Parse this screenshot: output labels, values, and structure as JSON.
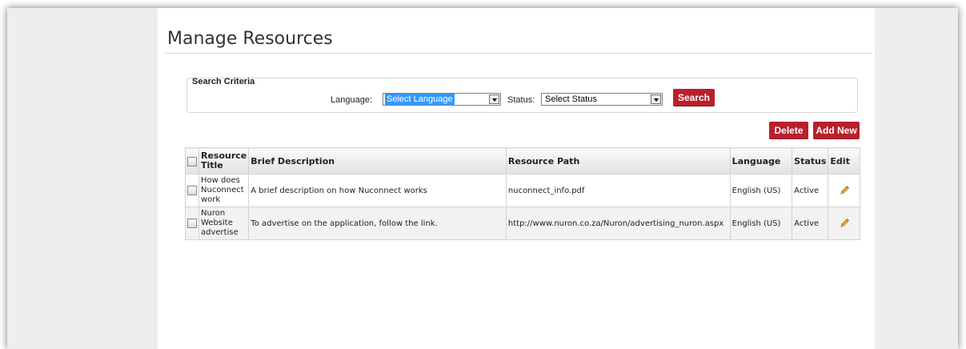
{
  "page": {
    "title": "Manage Resources"
  },
  "search": {
    "legend": "Search Criteria",
    "language_label": "Language:",
    "language_value": "Select Language",
    "status_label": "Status:",
    "status_value": "Select Status",
    "search_label": "Search"
  },
  "actions": {
    "delete_label": "Delete",
    "add_new_label": "Add New"
  },
  "table": {
    "headers": {
      "resource_title": "Resource Title",
      "brief_description": "Brief Description",
      "resource_path": "Resource Path",
      "language": "Language",
      "status": "Status",
      "edit": "Edit"
    },
    "rows": [
      {
        "title": "How does Nuconnect work",
        "description": "A brief description on how Nuconnect works",
        "path": "nuconnect_info.pdf",
        "language": "English (US)",
        "status": "Active"
      },
      {
        "title": "Nuron Website advertise",
        "description": "To advertise on the application, follow the link.",
        "path": "http://www.nuron.co.za/Nuron/advertising_nuron.aspx",
        "language": "English (US)",
        "status": "Active"
      }
    ]
  },
  "icons": {
    "edit": "pencil-icon",
    "select_arrow": "chevron-down-icon",
    "checkbox": "checkbox"
  },
  "colors": {
    "accent": "#b8202c",
    "select_highlight": "#3399ff",
    "background": "#eeeeee"
  }
}
